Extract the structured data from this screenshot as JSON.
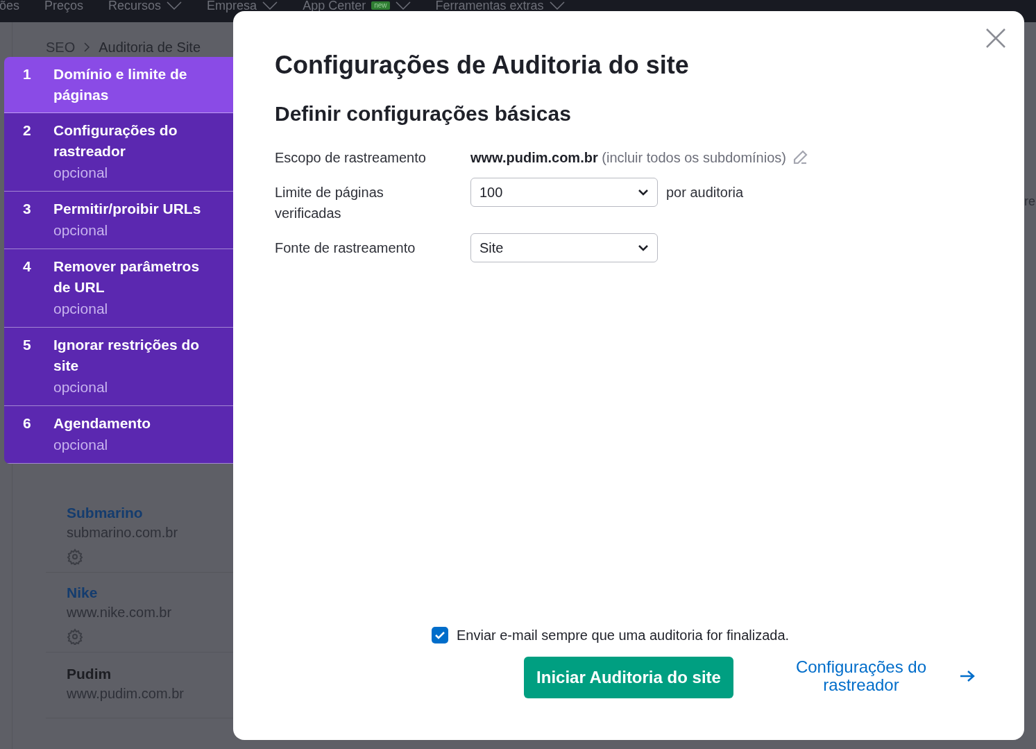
{
  "top_nav": [
    {
      "label": "ões",
      "has_menu": false
    },
    {
      "label": "Preços",
      "has_menu": false
    },
    {
      "label": "Recursos",
      "has_menu": true
    },
    {
      "label": "Empresa",
      "has_menu": true
    },
    {
      "label": "App Center",
      "has_menu": true,
      "badge": "new"
    },
    {
      "label": "Ferramentas extras",
      "has_menu": true
    }
  ],
  "breadcrumb": [
    "SEO",
    "Auditoria de Site"
  ],
  "projects": [
    {
      "name": "Submarino",
      "domain": "submarino.com.br",
      "linked": true
    },
    {
      "name": "Nike",
      "domain": "www.nike.com.br",
      "linked": true
    },
    {
      "name": "Pudim",
      "domain": "www.pudim.com.br",
      "linked": false
    }
  ],
  "background_edge_text": "re",
  "steps": [
    {
      "number": "1",
      "title": "Domínio e limite de páginas",
      "selected": true
    },
    {
      "number": "2",
      "title": "Configurações do rastreador",
      "subtitle": "opcional",
      "selected": false
    },
    {
      "number": "3",
      "title": "Permitir/proibir URLs",
      "subtitle": "opcional",
      "selected": false
    },
    {
      "number": "4",
      "title": "Remover parâmetros de URL",
      "subtitle": "opcional",
      "selected": false
    },
    {
      "number": "5",
      "title": "Ignorar restrições do site",
      "subtitle": "opcional",
      "selected": false
    },
    {
      "number": "6",
      "title": "Agendamento",
      "subtitle": "opcional",
      "selected": false
    }
  ],
  "modal": {
    "title": "Configurações de Auditoria do site",
    "section_title": "Definir configurações básicas",
    "fields": [
      {
        "kind": "scope",
        "label": "Escopo de rastreamento",
        "value": "www.pudim.com.br",
        "note": "(incluir todos os subdomínios)"
      },
      {
        "kind": "select",
        "label": "Limite de páginas verificadas",
        "value": "100",
        "suffix": "por auditoria"
      },
      {
        "kind": "select",
        "label": "Fonte de rastreamento",
        "value": "Site"
      }
    ],
    "email_checkbox": {
      "label": "Enviar e-mail sempre que uma auditoria for finalizada.",
      "checked": true
    },
    "start_button": "Iniciar Auditoria do site",
    "next_link": "Configurações do rastreador"
  }
}
